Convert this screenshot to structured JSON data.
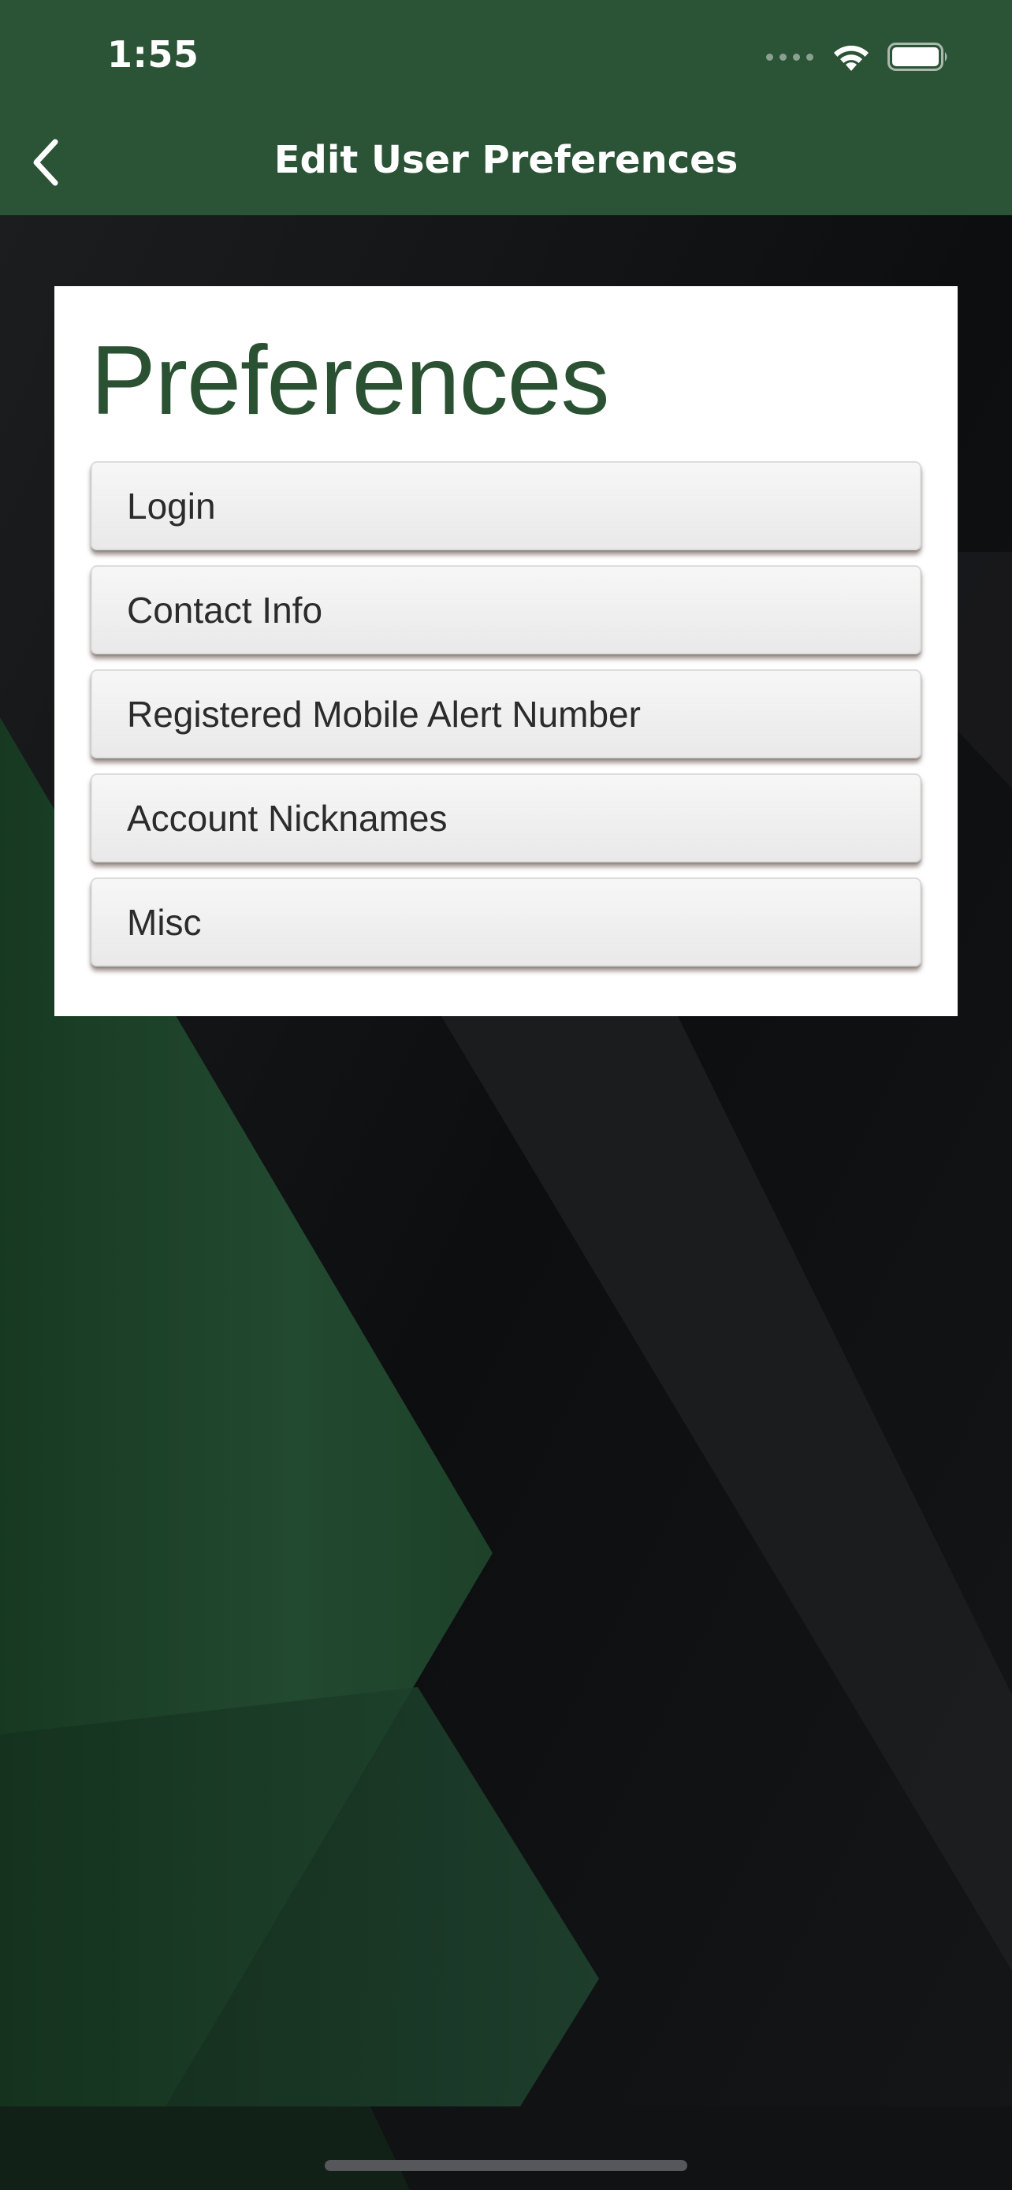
{
  "status_bar": {
    "time": "1:55",
    "icons": [
      "signal-icon",
      "wifi-icon",
      "battery-icon"
    ]
  },
  "nav": {
    "back_icon": "chevron-left-icon",
    "title": "Edit User Preferences"
  },
  "card": {
    "title": "Preferences",
    "items": [
      {
        "label": "Login"
      },
      {
        "label": "Contact Info"
      },
      {
        "label": "Registered Mobile Alert Number"
      },
      {
        "label": "Account Nicknames"
      },
      {
        "label": "Misc"
      }
    ]
  },
  "colors": {
    "brand_green": "#2b5336",
    "title_green": "#2a5132",
    "background_dark": "#0f1112"
  }
}
